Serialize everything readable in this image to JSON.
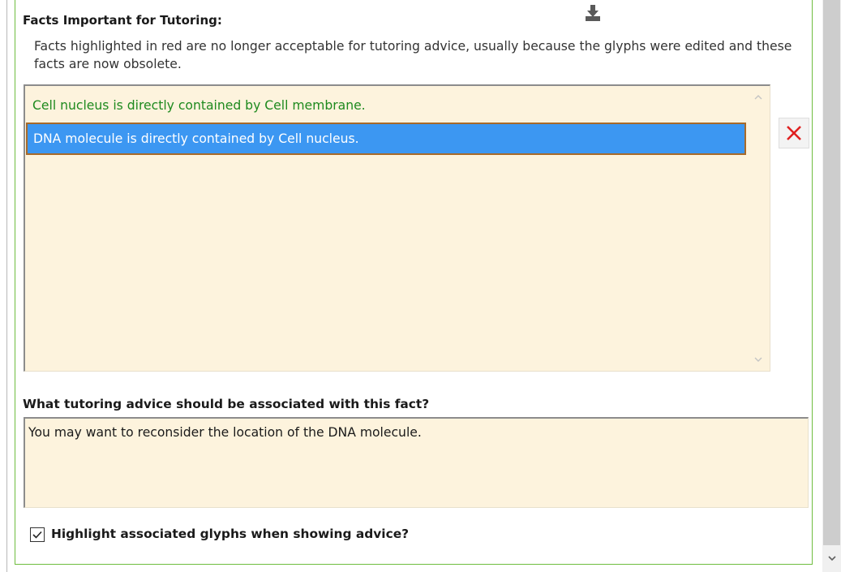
{
  "section": {
    "title": "Facts Important for Tutoring:",
    "description": "Facts highlighted in red are no longer acceptable for tutoring advice, usually because the glyphs were edited and these facts are now obsolete."
  },
  "icons": {
    "download": "download-icon",
    "delete": "red-x-delete-icon",
    "scroll_up": "chevron-up-icon",
    "scroll_down": "chevron-down-icon",
    "checkmark": "checkmark-icon"
  },
  "facts": [
    {
      "text": "Cell nucleus is directly contained by Cell membrane.",
      "state": "valid"
    },
    {
      "text": "DNA molecule is directly contained by Cell nucleus.",
      "state": "selected"
    }
  ],
  "advice": {
    "question": "What tutoring advice should be associated with this fact?",
    "value": "You may want to reconsider the location of the DNA molecule."
  },
  "highlight_option": {
    "label": "Highlight associated glyphs when showing advice?",
    "checked": true
  },
  "colors": {
    "panel_border": "#6fbd3f",
    "list_background": "#fdf3dd",
    "selection": "#3c97f2",
    "valid_fact_text": "#1e8a1e",
    "delete_red": "#e02020"
  }
}
